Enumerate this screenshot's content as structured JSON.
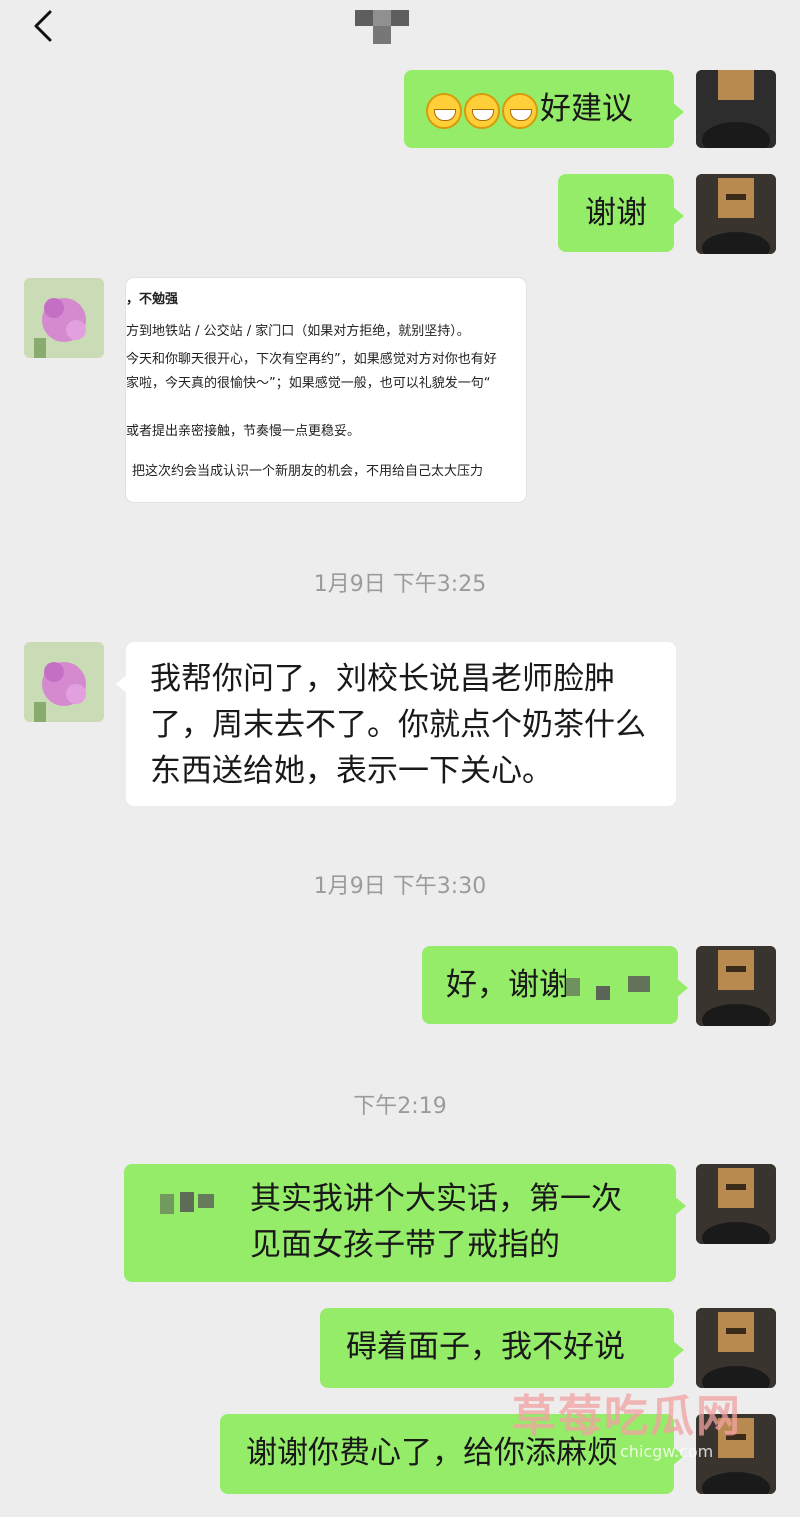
{
  "header": {
    "back_label": "<",
    "title": ""
  },
  "messages": [
    {
      "side": "me",
      "text": "好建议",
      "emoji_count": 3
    },
    {
      "side": "me",
      "text": "谢谢"
    },
    {
      "side": "them",
      "type": "image-card",
      "card_lines": [
        "，不勉强",
        "方到地铁站 / 公交站 / 家门口（如果对方拒绝，就别坚持）。",
        "今天和你聊天很开心，下次有空再约”，如果感觉对方对你也有好",
        "家啦，今天真的很愉快～”；如果感觉一般，也可以礼貌发一句“",
        "或者提出亲密接触，节奏慢一点更稳妥。",
        "把这次约会当成认识一个新朋友的机会，不用给自己太大压力"
      ]
    },
    {
      "type": "timestamp",
      "text": "1月9日 下午3:25"
    },
    {
      "side": "them",
      "text": "我帮你问了，刘校长说昌老师脸肿了，周末去不了。你就点个奶茶什么东西送给她，表示一下关心。"
    },
    {
      "type": "timestamp",
      "text": "1月9日 下午3:30"
    },
    {
      "side": "me",
      "text": "好，谢谢"
    },
    {
      "type": "timestamp",
      "text": "下午2:19"
    },
    {
      "side": "me",
      "text": "其实我讲个大实话，第一次见面女孩子带了戒指的"
    },
    {
      "side": "me",
      "text": "碍着面子，我不好说"
    },
    {
      "side": "me",
      "text": "谢谢你费心了，给你添麻烦"
    }
  ],
  "watermark": {
    "text": "草莓吃瓜网",
    "sub": "chicgw.com"
  },
  "colors": {
    "background": "#ededed",
    "my_bubble": "#95ec69",
    "their_bubble": "#ffffff",
    "timestamp": "#9b9b9b"
  }
}
